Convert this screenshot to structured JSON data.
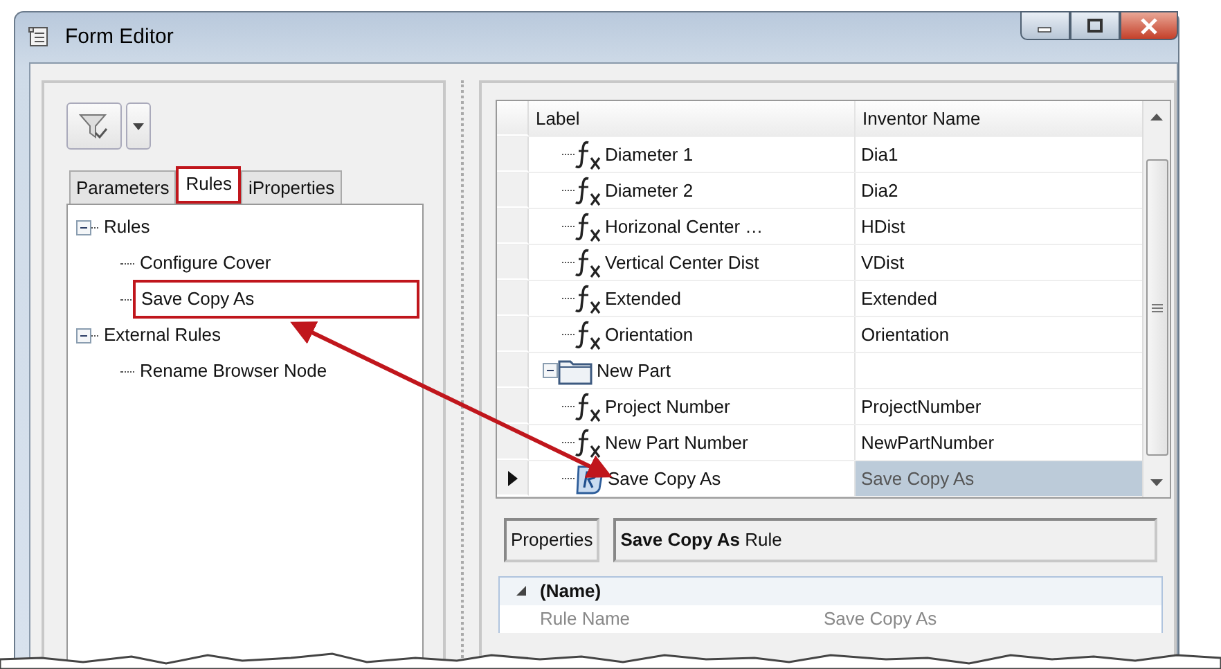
{
  "window": {
    "title": "Form Editor"
  },
  "tabs": [
    {
      "label": "Parameters",
      "selected": false,
      "highlighted": false
    },
    {
      "label": "Rules",
      "selected": true,
      "highlighted": true
    },
    {
      "label": "iProperties",
      "selected": false,
      "highlighted": false
    }
  ],
  "rules_tree": [
    {
      "label": "Rules",
      "expanded": true,
      "children": [
        {
          "label": "Configure Cover",
          "selected": false,
          "highlighted": false
        },
        {
          "label": "Save Copy As",
          "selected": true,
          "highlighted": true
        }
      ]
    },
    {
      "label": "External Rules",
      "expanded": true,
      "children": [
        {
          "label": "Rename Browser Node",
          "selected": false,
          "highlighted": false
        }
      ]
    }
  ],
  "grid": {
    "columns": [
      "Label",
      "Inventor Name"
    ],
    "rows": [
      {
        "kind": "parameter",
        "label": "Diameter 1",
        "inventor_name": "Dia1",
        "selected": false
      },
      {
        "kind": "parameter",
        "label": "Diameter 2",
        "inventor_name": "Dia2",
        "selected": false
      },
      {
        "kind": "parameter",
        "label": "Horizonal Center …",
        "inventor_name": "HDist",
        "selected": false
      },
      {
        "kind": "parameter",
        "label": "Vertical Center Dist",
        "inventor_name": "VDist",
        "selected": false
      },
      {
        "kind": "parameter",
        "label": "Extended",
        "inventor_name": "Extended",
        "selected": false
      },
      {
        "kind": "parameter",
        "label": "Orientation",
        "inventor_name": "Orientation",
        "selected": false
      },
      {
        "kind": "group",
        "label": "New Part",
        "expanded": true,
        "selected": false,
        "children": [
          {
            "kind": "parameter",
            "label": "Project Number",
            "inventor_name": "ProjectNumber",
            "selected": false
          },
          {
            "kind": "parameter",
            "label": "New Part Number",
            "inventor_name": "NewPartNumber",
            "selected": false
          },
          {
            "kind": "rule",
            "label": "Save Copy As",
            "inventor_name": "Save Copy As",
            "selected": true
          }
        ]
      }
    ]
  },
  "properties": {
    "label": "Properties",
    "title": "**Save Copy As** Rule",
    "categories": [
      {
        "label": "(Name)",
        "expanded": true,
        "rows": [
          {
            "name": "Rule Name",
            "value": "Save Copy As"
          }
        ]
      }
    ]
  }
}
